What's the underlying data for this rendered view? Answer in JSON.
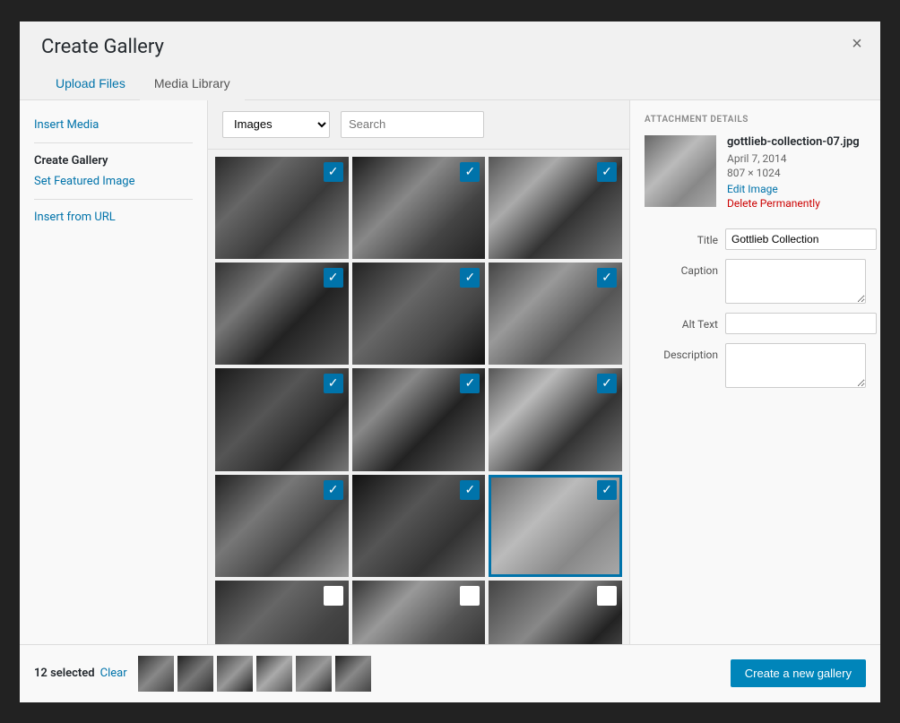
{
  "modal": {
    "title": "Create Gallery",
    "close_label": "×"
  },
  "tabs": [
    {
      "id": "upload",
      "label": "Upload Files",
      "active": false
    },
    {
      "id": "library",
      "label": "Media Library",
      "active": true
    }
  ],
  "sidebar": {
    "links": [
      {
        "id": "insert-media",
        "label": "Insert Media",
        "active": false
      },
      {
        "id": "create-gallery",
        "label": "Create Gallery",
        "active": true
      },
      {
        "id": "set-featured",
        "label": "Set Featured Image",
        "active": false
      },
      {
        "id": "insert-url",
        "label": "Insert from URL",
        "active": false
      }
    ]
  },
  "toolbar": {
    "filter_label": "Images",
    "filter_placeholder": "Images",
    "search_placeholder": "Search"
  },
  "attachment_details": {
    "section_title": "ATTACHMENT DETAILS",
    "filename": "gottlieb-collection-07.jpg",
    "date": "April 7, 2014",
    "dimensions": "807 × 1024",
    "edit_label": "Edit Image",
    "delete_label": "Delete Permanently",
    "fields": {
      "title_label": "Title",
      "title_value": "Gottlieb Collection",
      "caption_label": "Caption",
      "caption_value": "",
      "alt_text_label": "Alt Text",
      "alt_text_value": "",
      "description_label": "Description",
      "description_value": ""
    }
  },
  "footer": {
    "selected_count": "12 selected",
    "clear_label": "Clear",
    "create_gallery_label": "Create a new gallery"
  },
  "media_items": [
    {
      "id": 1,
      "checked": true,
      "photo_class": "photo-1"
    },
    {
      "id": 2,
      "checked": true,
      "photo_class": "photo-2"
    },
    {
      "id": 3,
      "checked": true,
      "photo_class": "photo-3"
    },
    {
      "id": 4,
      "checked": true,
      "photo_class": "photo-4"
    },
    {
      "id": 5,
      "checked": true,
      "photo_class": "photo-5"
    },
    {
      "id": 6,
      "checked": true,
      "photo_class": "photo-6"
    },
    {
      "id": 7,
      "checked": true,
      "photo_class": "photo-7"
    },
    {
      "id": 8,
      "checked": true,
      "photo_class": "photo-8"
    },
    {
      "id": 9,
      "checked": true,
      "photo_class": "photo-9"
    },
    {
      "id": 10,
      "checked": true,
      "photo_class": "photo-10"
    },
    {
      "id": 11,
      "checked": true,
      "photo_class": "photo-11"
    },
    {
      "id": 12,
      "checked": true,
      "photo_class": "photo-12",
      "selected": true
    },
    {
      "id": 13,
      "checked": false,
      "photo_class": "photo-13"
    },
    {
      "id": 14,
      "checked": false,
      "photo_class": "photo-14"
    },
    {
      "id": 15,
      "checked": false,
      "photo_class": "photo-15"
    }
  ],
  "selected_thumbs": [
    {
      "id": 1,
      "thumb_class": "thumb-1"
    },
    {
      "id": 2,
      "thumb_class": "thumb-2"
    },
    {
      "id": 3,
      "thumb_class": "thumb-3"
    },
    {
      "id": 4,
      "thumb_class": "thumb-4"
    },
    {
      "id": 5,
      "thumb_class": "thumb-5"
    },
    {
      "id": 6,
      "thumb_class": "thumb-6"
    }
  ]
}
